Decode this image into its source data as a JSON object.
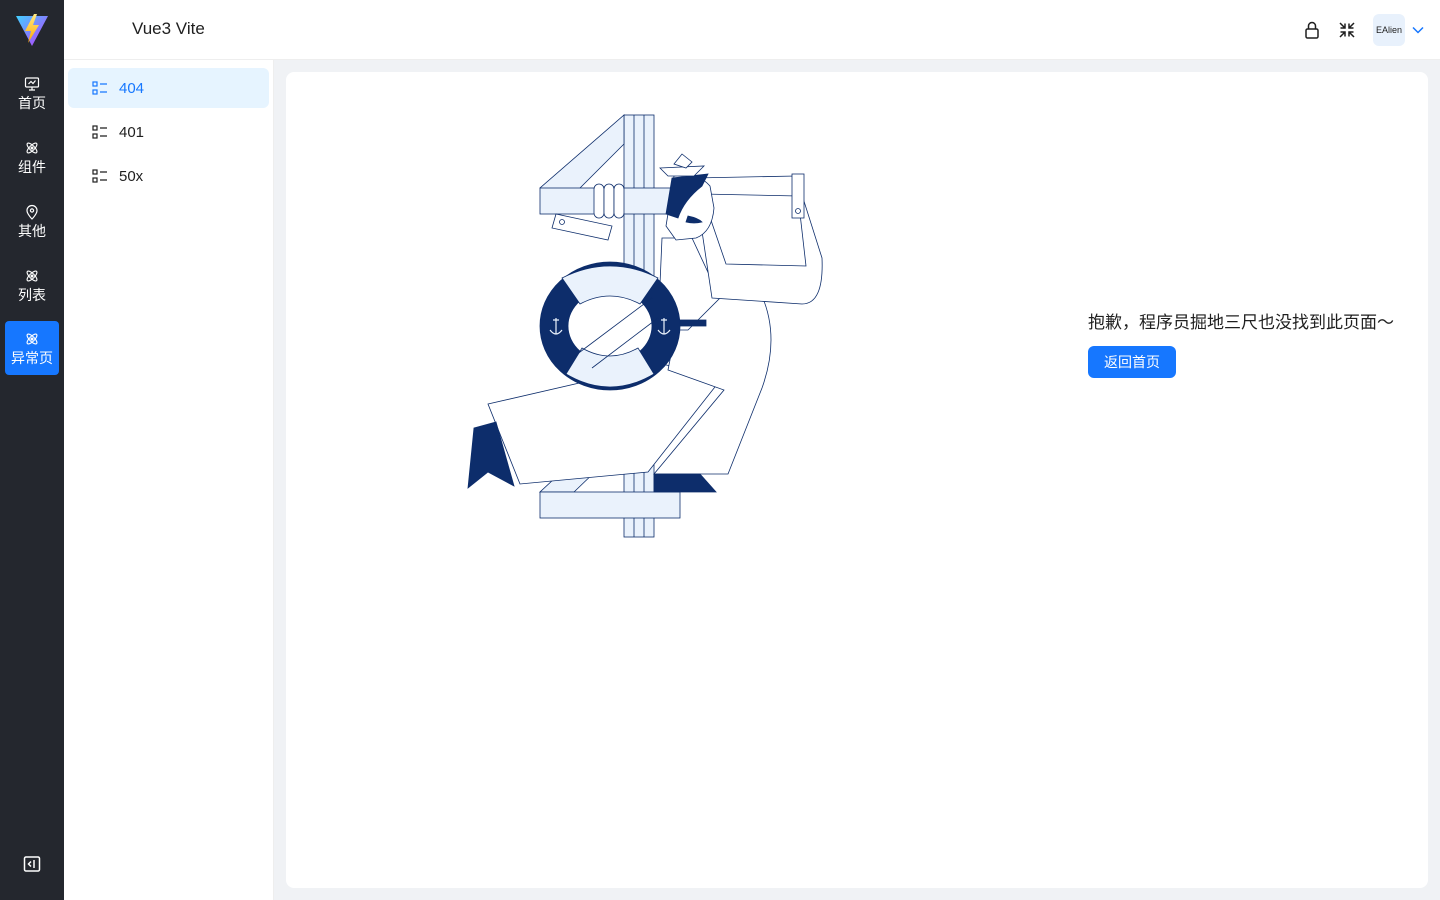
{
  "app": {
    "title": "Vue3 Vite"
  },
  "rail": {
    "items": [
      {
        "label": "首页",
        "icon": "dashboard-icon"
      },
      {
        "label": "组件",
        "icon": "atom-icon"
      },
      {
        "label": "其他",
        "icon": "location-pin-icon"
      },
      {
        "label": "列表",
        "icon": "atom-icon"
      },
      {
        "label": "异常页",
        "icon": "atom-icon",
        "active": true
      }
    ]
  },
  "header": {
    "user_name": "EAlien"
  },
  "submenu": {
    "items": [
      {
        "label": "404",
        "active": true
      },
      {
        "label": "401"
      },
      {
        "label": "50x"
      }
    ]
  },
  "error_page": {
    "message": "抱歉，程序员掘地三尺也没找到此页面～",
    "button_label": "返回首页"
  },
  "colors": {
    "primary": "#1677ff",
    "rail_bg": "#24272e",
    "active_bg": "#e6f4ff",
    "illustration_navy": "#0d2d6b",
    "illustration_fill": "#eaf2fc"
  }
}
